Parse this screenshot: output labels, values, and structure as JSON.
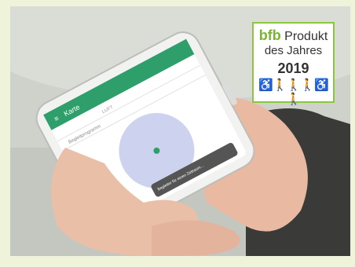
{
  "badge": {
    "brand": "bfb",
    "word1": "Produkt",
    "line2": "des Jahres",
    "year": "2019",
    "icons": "♿🚶🚶🚶♿🚶"
  },
  "app": {
    "title": "Karte",
    "tab_label": "LUFT",
    "list_item": "Begleitprogramm",
    "toast": "Begleiter für einen Zeitraum..."
  },
  "colors": {
    "accent": "#2e9e6a",
    "badge_border": "#8cc63f"
  }
}
